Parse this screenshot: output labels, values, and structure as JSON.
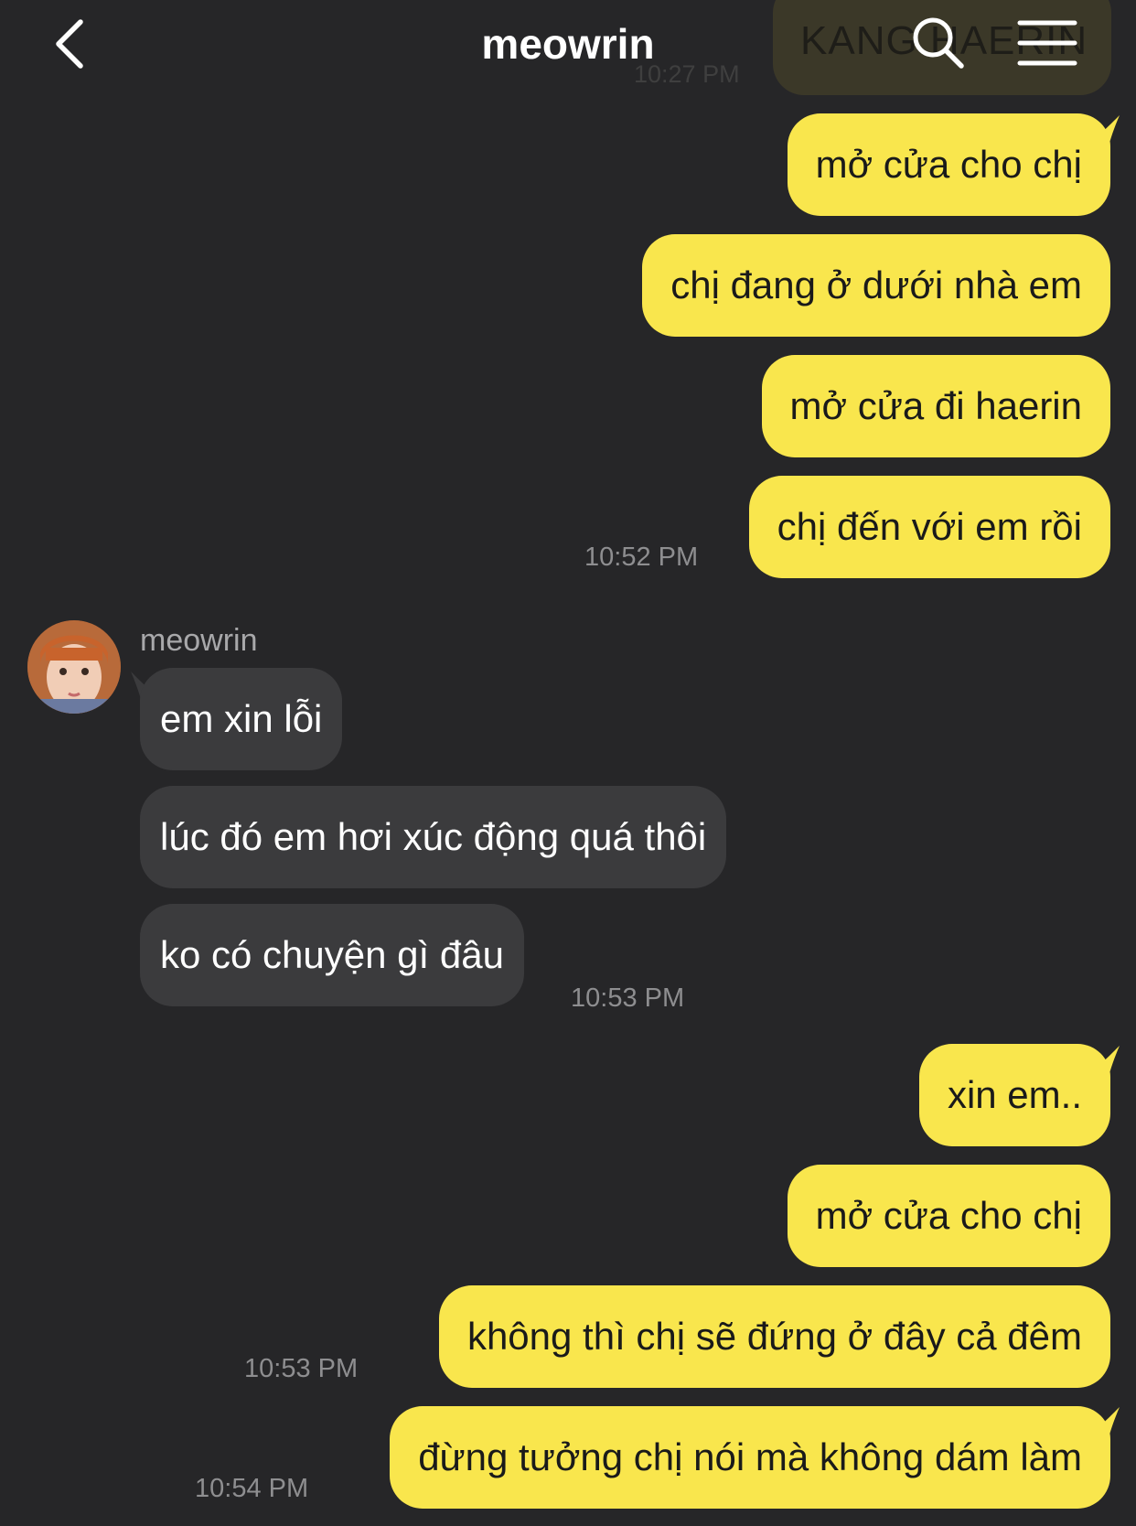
{
  "header": {
    "title": "meowrin",
    "back_icon": "chevron-left-icon",
    "search_icon": "search-icon",
    "menu_icon": "hamburger-menu-icon"
  },
  "pinned_preview": {
    "text": "KANG HAERIN",
    "time": "10:27 PM"
  },
  "colors": {
    "background": "#262628",
    "outgoing_bubble": "#f9e64d",
    "incoming_bubble": "#3b3b3d",
    "timestamp": "#8e8e90"
  },
  "contact": {
    "name": "meowrin"
  },
  "messages": {
    "m1": "mở cửa cho chị",
    "m2": "chị đang ở dưới nhà em",
    "m3": "mở cửa đi haerin",
    "m4": "chị đến với em rồi",
    "t1": "10:52 PM",
    "r1": "em xin lỗi",
    "r2": "lúc đó em hơi xúc động quá thôi",
    "r3": "ko có chuyện gì đâu",
    "t2": "10:53 PM",
    "m5": "xin em..",
    "m6": "mở cửa cho chị",
    "m7": "không thì chị sẽ đứng ở đây cả đêm",
    "t3": "10:53 PM",
    "m8": "đừng tưởng chị nói mà không dám làm",
    "t4": "10:54 PM"
  }
}
